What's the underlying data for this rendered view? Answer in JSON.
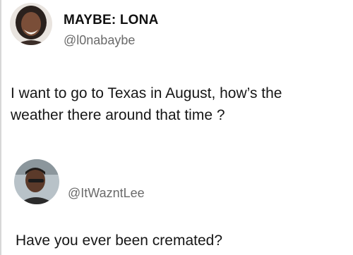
{
  "tweet": {
    "author_name": "MAYBE: LONA",
    "author_handle": "@l0nabaybe",
    "text_line1": "I want to go to Texas in August, how’s the",
    "text_line2": "weather there around that time ?"
  },
  "reply": {
    "author_handle": "@ItWazntLee",
    "text": "Have you ever been cremated?"
  },
  "icons": [
    "avatar",
    "avatar"
  ]
}
